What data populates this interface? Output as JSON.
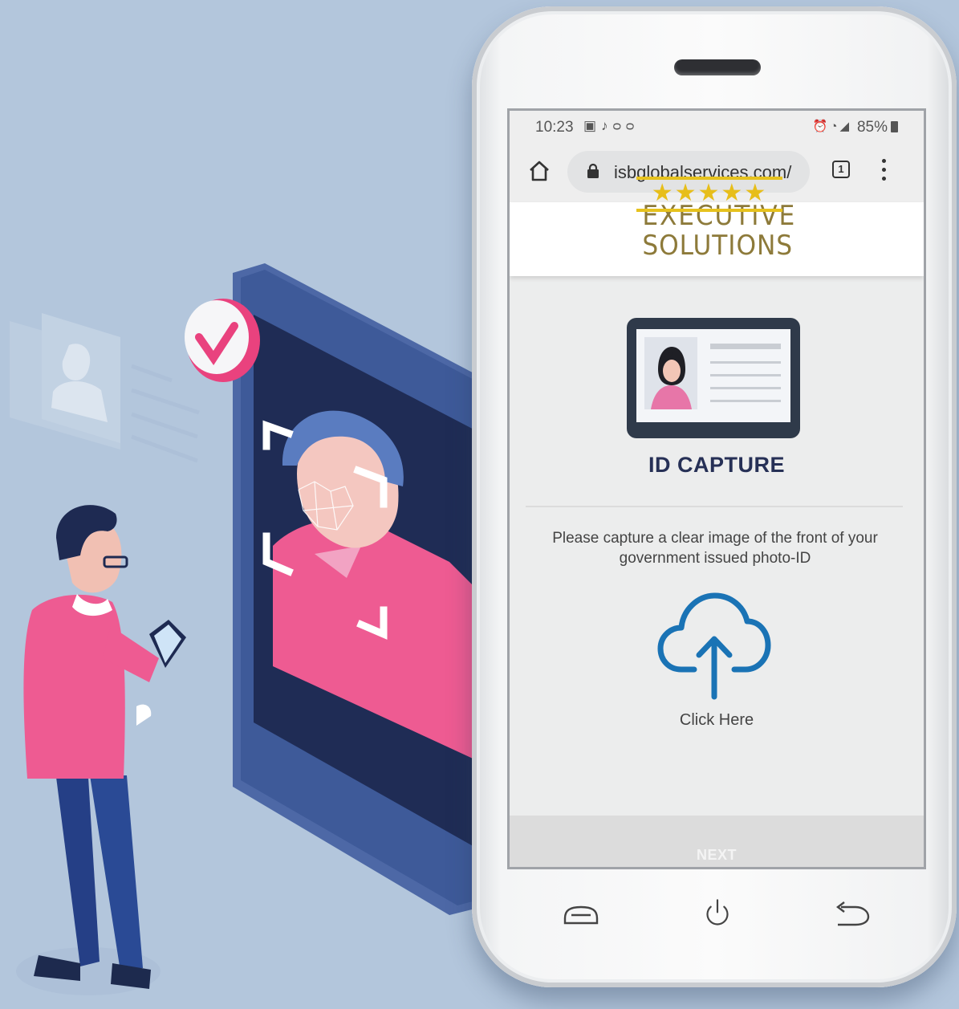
{
  "status_bar": {
    "time": "10:23",
    "left_icons": [
      "image-icon",
      "music-note-icon",
      "voicemail-icon"
    ],
    "right_icons": [
      "alarm-icon",
      "wifi-icon",
      "signal-icon"
    ],
    "battery": "85%"
  },
  "browser": {
    "url": "isbglobalservices.com/",
    "tab_count": "1",
    "icons": [
      "home-icon",
      "lock-icon",
      "tabs-icon",
      "menu-icon"
    ]
  },
  "logo": {
    "line1": "EXECUTIVE",
    "line2": "SOLUTIONS",
    "stars": "★★★★★",
    "colors": {
      "text": "#8d7a3a",
      "accent": "#e6c21e"
    }
  },
  "id_capture": {
    "title": "ID CAPTURE",
    "instructions": "Please capture a clear image of the front of your government issued photo-ID",
    "upload_label": "Click Here",
    "next_label": "NEXT"
  },
  "hardware_buttons": [
    "recent-apps-icon",
    "power-icon",
    "back-icon"
  ],
  "colors": {
    "background": "#b3c6dc",
    "title": "#263056",
    "upload_icon": "#1a73b5",
    "illustration_pink": "#ee5b92",
    "illustration_navy": "#233a6b"
  }
}
